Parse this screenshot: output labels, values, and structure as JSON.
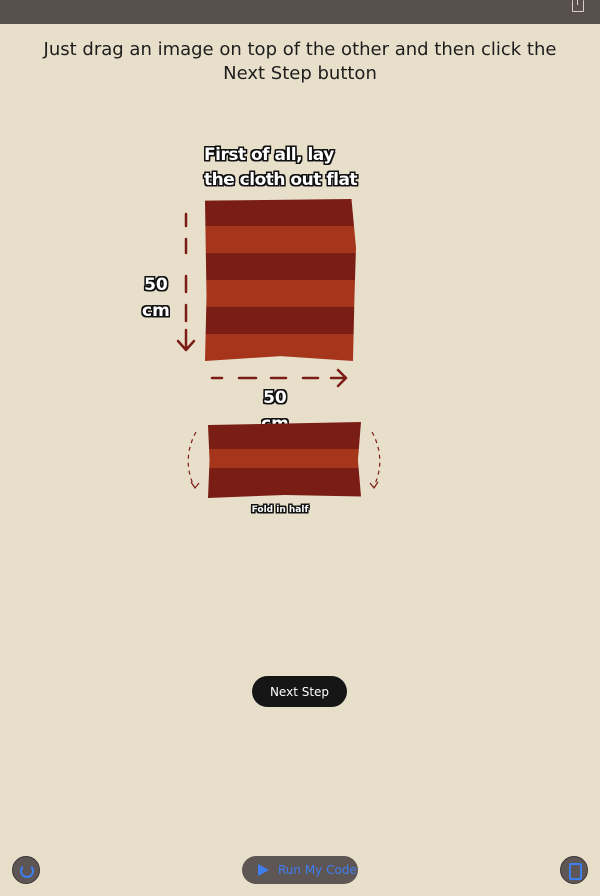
{
  "instruction": "Just drag an image on top of the other and then click the Next Step button",
  "step1": {
    "caption_line1": "First of all, lay",
    "caption_line2": "the cloth out flat",
    "height_value": "50",
    "height_unit": "cm",
    "width_value": "50",
    "width_unit": "cm"
  },
  "step2": {
    "caption": "Fold in half"
  },
  "next_button": "Next Step",
  "run_button": "Run My Code",
  "colors": {
    "background": "#e8dfcb",
    "cloth_dark": "#7a1d14",
    "cloth_light": "#a6361b",
    "accent_blue": "#3d7ef0"
  },
  "icons": {
    "top_right": "share-icon",
    "bottom_left": "timer-icon",
    "bottom_right": "document-icon"
  }
}
